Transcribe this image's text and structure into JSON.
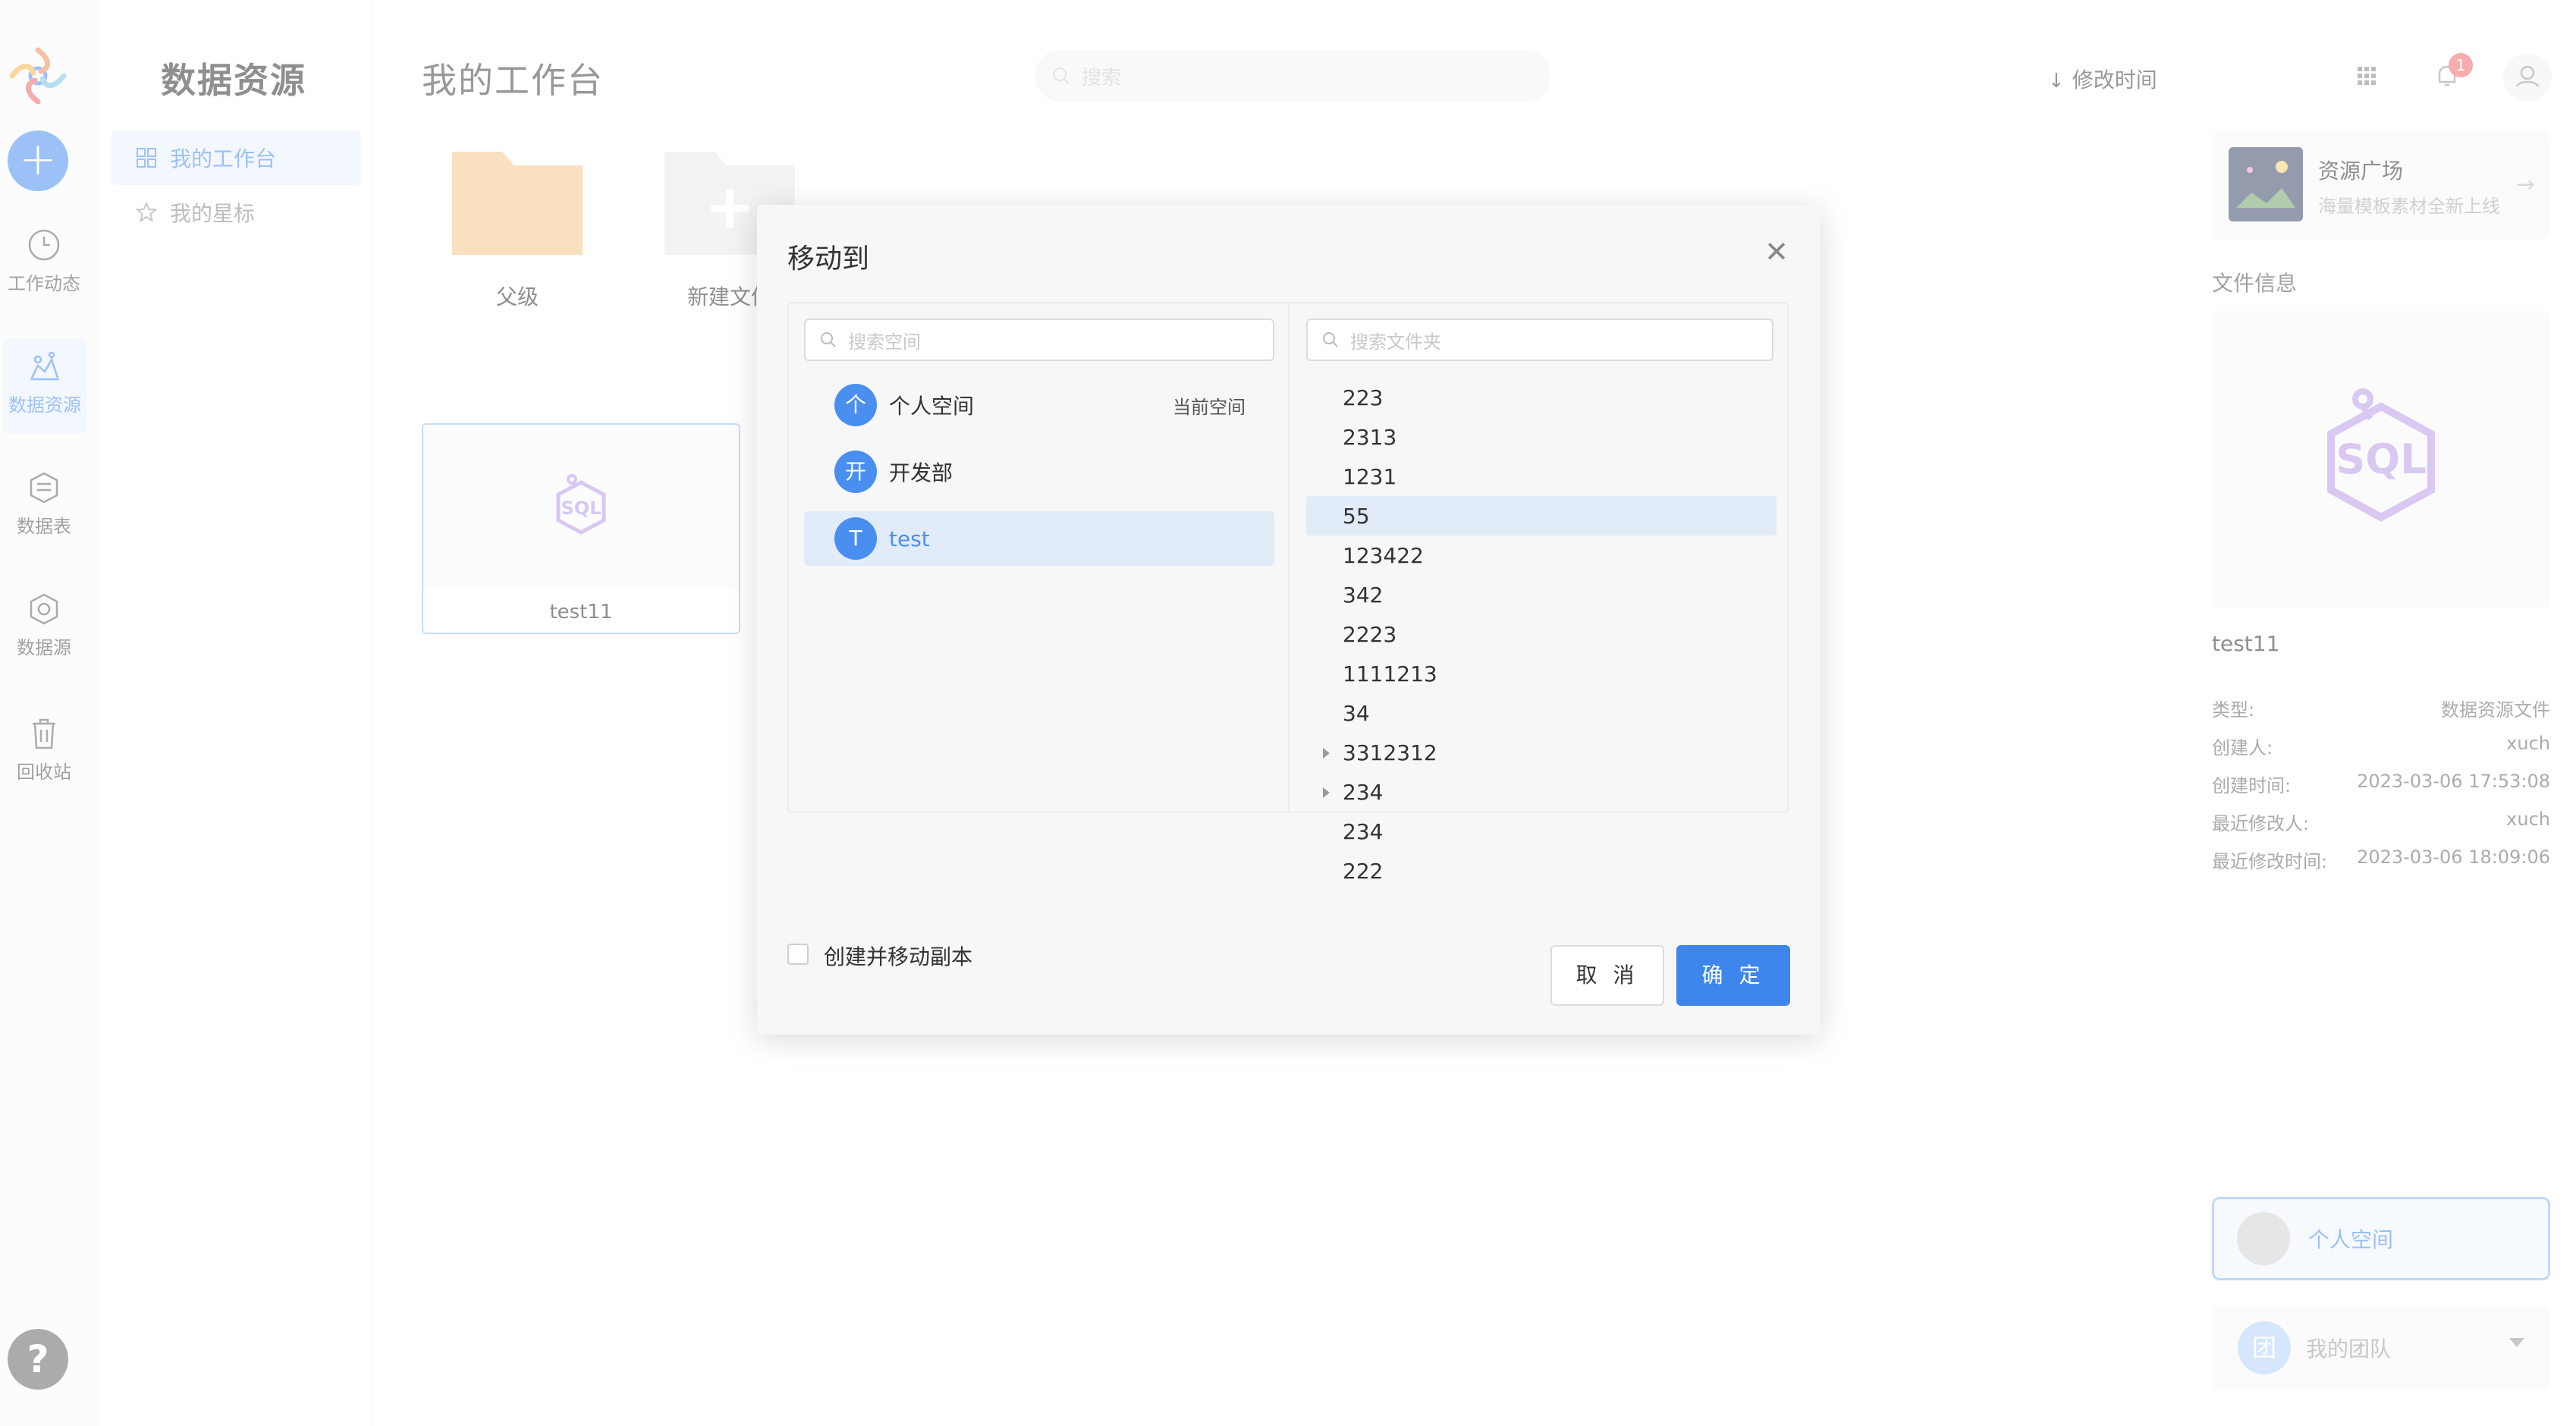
{
  "sidebar": {
    "items": [
      {
        "label": "工作动态",
        "icon": "clock-icon"
      },
      {
        "label": "数据资源",
        "icon": "data-resource-icon",
        "active": true
      },
      {
        "label": "数据表",
        "icon": "data-table-icon"
      },
      {
        "label": "数据源",
        "icon": "data-source-icon"
      },
      {
        "label": "回收站",
        "icon": "trash-icon"
      }
    ],
    "help": "?"
  },
  "nav": {
    "title": "数据资源",
    "items": [
      {
        "label": "我的工作台",
        "icon": "grid-icon",
        "active": true
      },
      {
        "label": "我的星标",
        "icon": "star-icon"
      }
    ]
  },
  "header": {
    "title": "我的工作台",
    "search_placeholder": "搜索",
    "sort_label": "修改时间",
    "notification_count": "1"
  },
  "main": {
    "folders": [
      {
        "label": "父级"
      },
      {
        "label": "新建文件"
      }
    ],
    "files": [
      {
        "name": "test11"
      }
    ]
  },
  "right_panel": {
    "banner": {
      "title": "资源广场",
      "subtitle": "海量模板素材全新上线"
    },
    "file_info_title": "文件信息",
    "file_name": "test11",
    "meta": [
      {
        "label": "类型:",
        "value": "数据资源文件"
      },
      {
        "label": "创建人:",
        "value": "xuch"
      },
      {
        "label": "创建时间:",
        "value": "2023-03-06 17:53:08"
      },
      {
        "label": "最近修改人:",
        "value": "xuch"
      },
      {
        "label": "最近修改时间:",
        "value": "2023-03-06 18:09:06"
      }
    ],
    "space_label": "个人空间",
    "team_label": "我的团队",
    "team_avatar": "团"
  },
  "modal": {
    "title": "移动到",
    "space_search_placeholder": "搜索空间",
    "folder_search_placeholder": "搜索文件夹",
    "spaces": [
      {
        "avatar": "个",
        "label": "个人空间",
        "tag": "当前空间"
      },
      {
        "avatar": "开",
        "label": "开发部",
        "tag": ""
      },
      {
        "avatar": "T",
        "label": "test",
        "tag": "",
        "active": true
      }
    ],
    "folders": [
      {
        "label": "223"
      },
      {
        "label": "2313"
      },
      {
        "label": "1231"
      },
      {
        "label": "55",
        "active": true
      },
      {
        "label": "123422"
      },
      {
        "label": "342"
      },
      {
        "label": "2223"
      },
      {
        "label": "1111213"
      },
      {
        "label": "34"
      },
      {
        "label": "3312312",
        "expandable": true
      },
      {
        "label": "234",
        "expandable": true
      },
      {
        "label": "234"
      },
      {
        "label": "222"
      }
    ],
    "copy_label": "创建并移动副本",
    "cancel_label": "取 消",
    "ok_label": "确 定"
  },
  "colors": {
    "accent": "#4a8ff0",
    "folder": "#f5c98a",
    "sql_purple": "#b99be8",
    "badge": "#f06b6b"
  }
}
